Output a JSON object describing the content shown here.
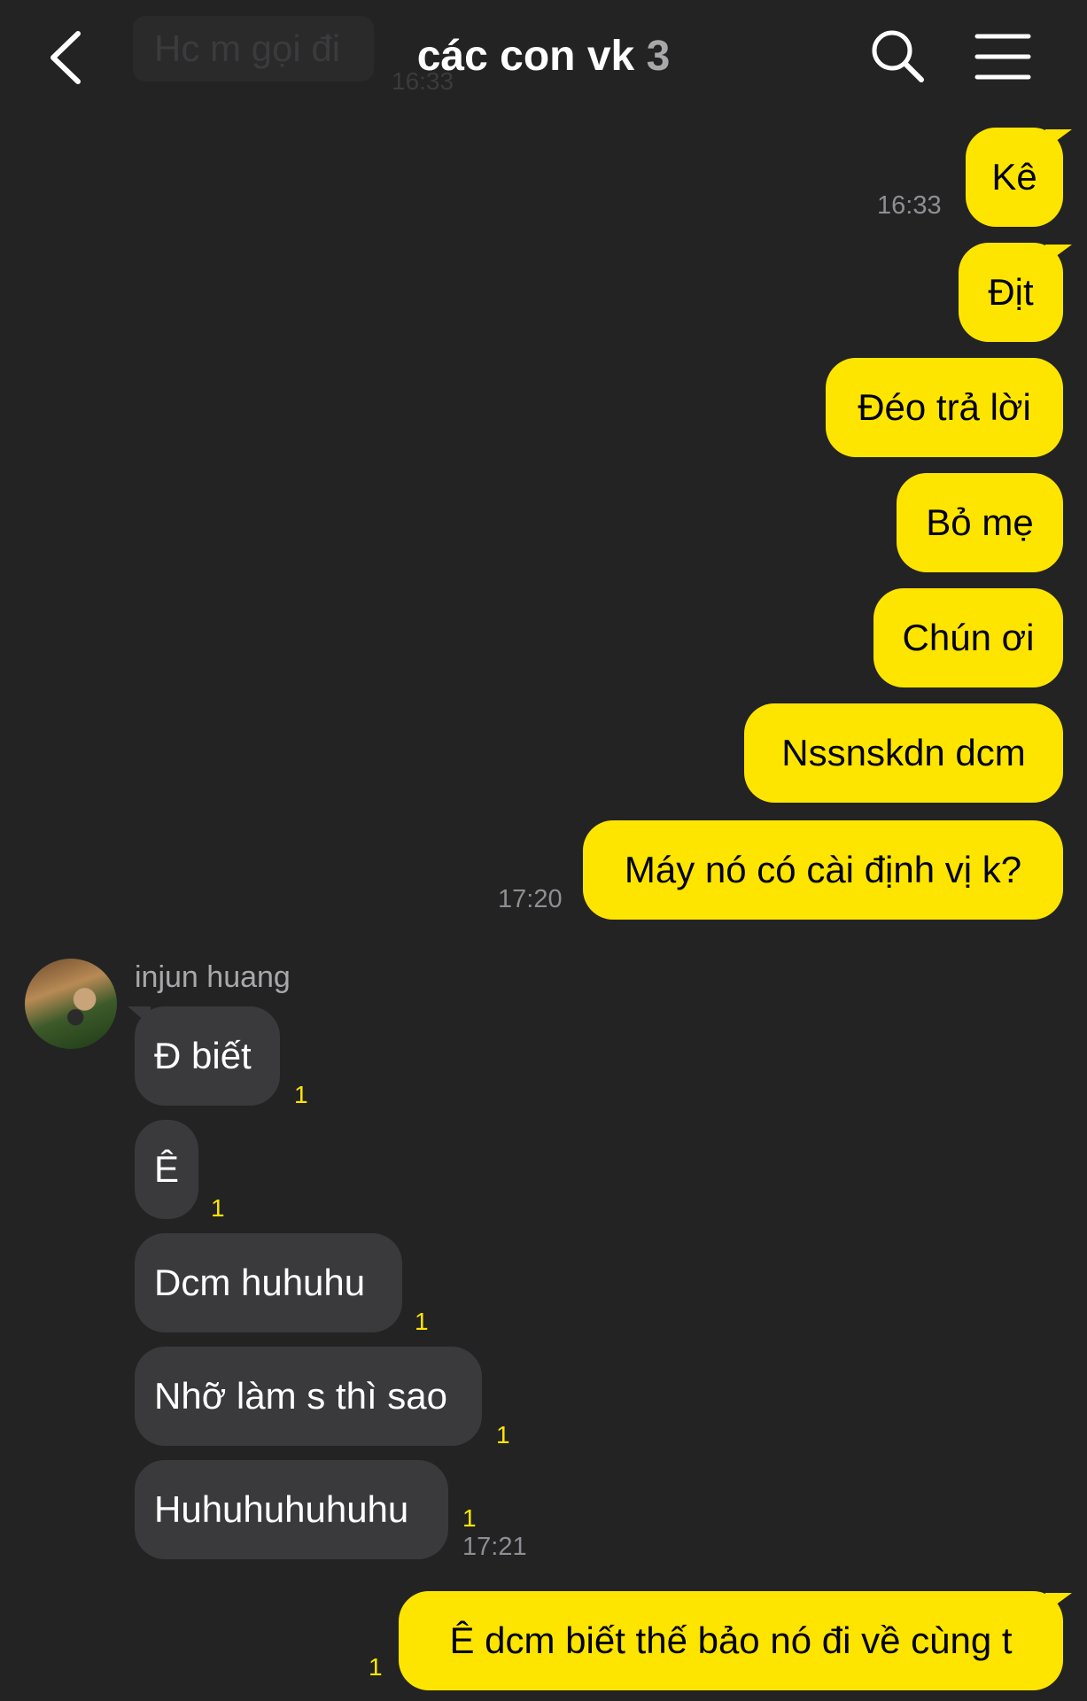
{
  "header": {
    "title": "các con vk",
    "member_count": "3",
    "ghost_message": "Hc m gọi đi",
    "ghost_time": "16:33"
  },
  "messages": {
    "out1": {
      "text": "Kê",
      "time": "16:33"
    },
    "out2": {
      "text": "Địt"
    },
    "out3": {
      "text": "Đéo trả lời"
    },
    "out4": {
      "text": "Bỏ mẹ"
    },
    "out5": {
      "text": "Chún ơi"
    },
    "out6": {
      "text": "Nssnskdn dcm"
    },
    "out7": {
      "text": "Máy nó có cài định vị k?",
      "time": "17:20"
    },
    "sender_name": "injun huang",
    "in1": {
      "text": "Đ biết",
      "unread": "1"
    },
    "in2": {
      "text": "Ê",
      "unread": "1"
    },
    "in3": {
      "text": "Dcm huhuhu",
      "unread": "1"
    },
    "in4": {
      "text": "Nhỡ làm s thì sao",
      "unread": "1"
    },
    "in5": {
      "text": "Huhuhuhuhuhu",
      "unread": "1",
      "time": "17:21"
    },
    "out8": {
      "text": "Ê dcm biết thế bảo nó đi về cùng t",
      "unread": "1"
    }
  },
  "colors": {
    "background": "#232324",
    "outgoing_bubble": "#fee500",
    "incoming_bubble": "#3a3a3c",
    "unread_count": "#fee500"
  },
  "icons": {
    "back": "chevron-left-icon",
    "search": "search-icon",
    "menu": "hamburger-menu-icon"
  }
}
